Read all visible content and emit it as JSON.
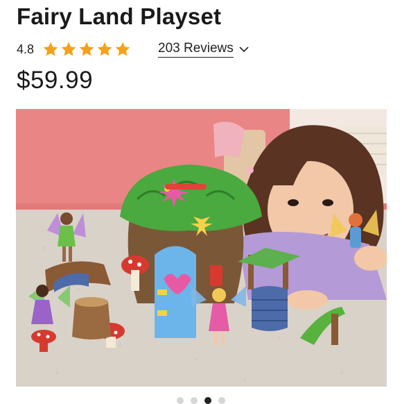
{
  "product": {
    "title": "Fairy Land Playset",
    "rating": "4.8",
    "rating_stars": 5,
    "reviews_label": "203 Reviews",
    "price": "$59.99"
  },
  "colors": {
    "star": "#f4a21a",
    "text": "#1a1a1a",
    "dot_active": "#222222",
    "dot_inactive": "#d6d6d6"
  },
  "icons": {
    "star": "star-icon",
    "chevron": "chevron-down-icon"
  },
  "carousel": {
    "slide_count": 4,
    "active_index": 2
  }
}
